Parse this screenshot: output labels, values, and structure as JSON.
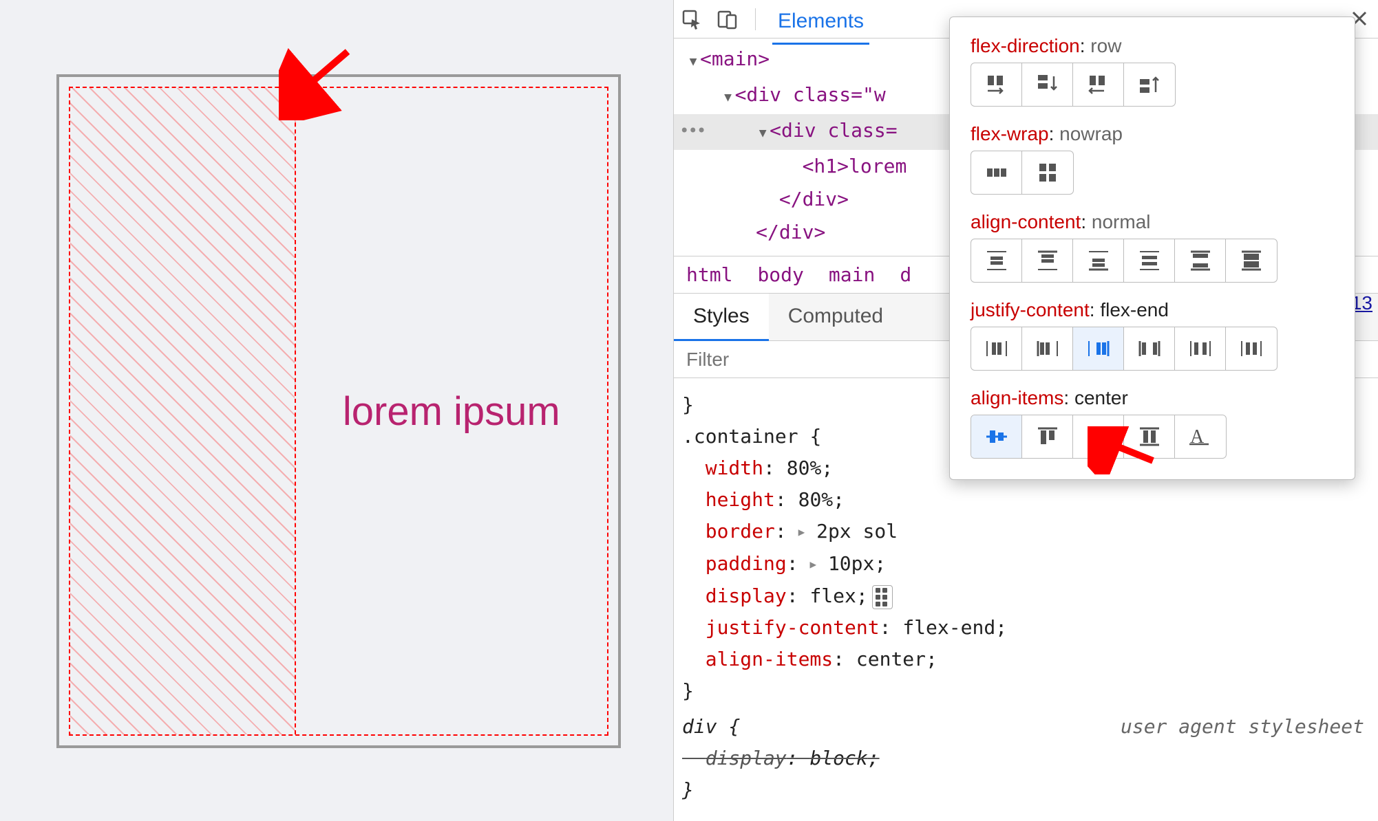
{
  "preview": {
    "text": "lorem ipsum"
  },
  "devtools": {
    "tabs": {
      "elements": "Elements"
    },
    "dom": {
      "main_open": "<main>",
      "div_w": "<div class=\"w",
      "div_class": "<div class=",
      "h1": "<h1>lorem",
      "div_close1": "</div>",
      "div_close2": "</div>"
    },
    "breadcrumb": [
      "html",
      "body",
      "main",
      "d"
    ],
    "subtabs": {
      "styles": "Styles",
      "computed": "Computed"
    },
    "filter_placeholder": "Filter",
    "styles": {
      "brace_close_top": "}",
      "selector": ".container",
      "rules": [
        {
          "prop": "width",
          "val": "80%"
        },
        {
          "prop": "height",
          "val": "80%"
        },
        {
          "prop": "border",
          "val": "2px sol"
        },
        {
          "prop": "padding",
          "val": "10px"
        },
        {
          "prop": "display",
          "val": "flex"
        },
        {
          "prop": "justify-content",
          "val": "flex-end"
        },
        {
          "prop": "align-items",
          "val": "center"
        }
      ],
      "ua_label": "user agent stylesheet",
      "ua_selector": "div",
      "ua_rule_prop": "display",
      "ua_rule_val": "block"
    },
    "link13": "13"
  },
  "flex_popover": {
    "groups": [
      {
        "prop": "flex-direction",
        "val": "row",
        "val_black": false,
        "active": null
      },
      {
        "prop": "flex-wrap",
        "val": "nowrap",
        "val_black": false,
        "active": null
      },
      {
        "prop": "align-content",
        "val": "normal",
        "val_black": false,
        "active": null
      },
      {
        "prop": "justify-content",
        "val": "flex-end",
        "val_black": true,
        "active": 2
      },
      {
        "prop": "align-items",
        "val": "center",
        "val_black": true,
        "active": 0
      }
    ]
  }
}
